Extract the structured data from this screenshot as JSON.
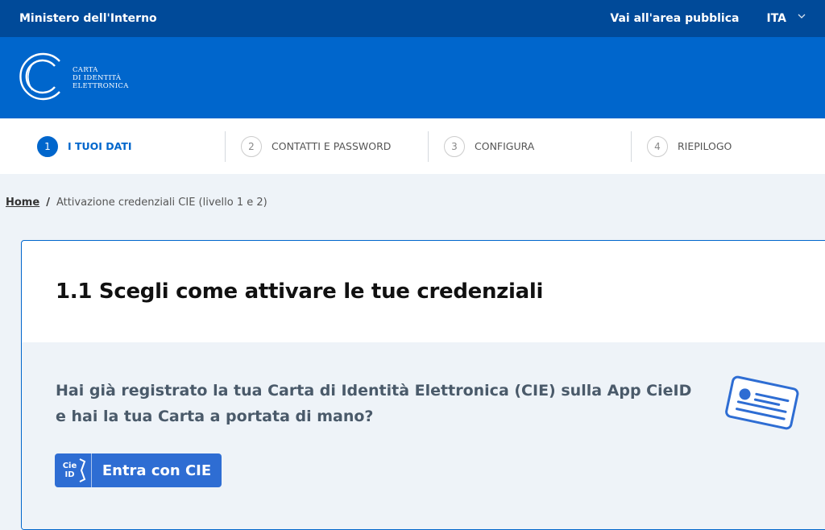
{
  "topbar": {
    "ministry": "Ministero dell'Interno",
    "public_area_link": "Vai all'area pubblica",
    "language": "ITA"
  },
  "brand": {
    "logo_line1": "CARTA",
    "logo_line2": "DI IDENTITÀ",
    "logo_line3": "ELETTRONICA"
  },
  "steps": [
    {
      "number": "1",
      "label": "I TUOI DATI",
      "active": true
    },
    {
      "number": "2",
      "label": "CONTATTI E PASSWORD",
      "active": false
    },
    {
      "number": "3",
      "label": "CONFIGURA",
      "active": false
    },
    {
      "number": "4",
      "label": "RIEPILOGO",
      "active": false
    }
  ],
  "breadcrumb": {
    "home": "Home",
    "separator": "/",
    "current": "Attivazione credenziali CIE (livello 1 e 2)"
  },
  "card": {
    "title": "1.1 Scegli come attivare le tue credenziali",
    "question": "Hai già registrato la tua Carta di Identità Elettronica (CIE) sulla App CieID e hai la tua Carta a portata di mano?",
    "button_label": "Entra con CIE",
    "button_logo_text_1": "Cie",
    "button_logo_text_2": "ID"
  },
  "colors": {
    "topbar": "#004a99",
    "brand": "#0066cc",
    "accent": "#0066cc",
    "button": "#2e6dd3"
  },
  "icons": [
    "cie-logo-icon",
    "chevron-down-icon",
    "id-card-icon"
  ]
}
